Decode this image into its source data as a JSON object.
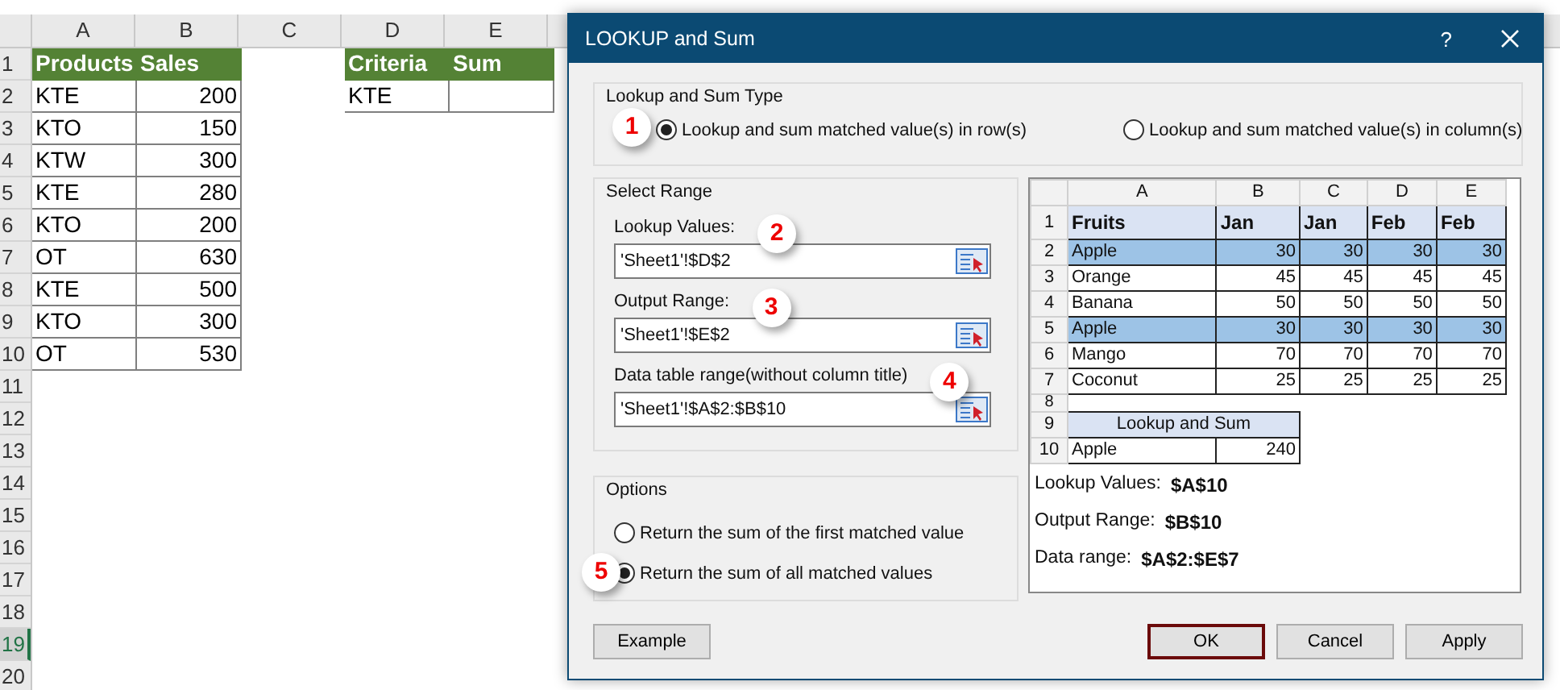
{
  "spreadsheet": {
    "columns": [
      "A",
      "B",
      "C",
      "D",
      "E"
    ],
    "row_headers": [
      {
        "label": "1",
        "selected": false
      },
      {
        "label": "2",
        "selected": false
      },
      {
        "label": "3",
        "selected": false
      },
      {
        "label": "4",
        "selected": false
      },
      {
        "label": "5",
        "selected": false
      },
      {
        "label": "6",
        "selected": false
      },
      {
        "label": "7",
        "selected": false
      },
      {
        "label": "8",
        "selected": false
      },
      {
        "label": "9",
        "selected": false
      },
      {
        "label": "10",
        "selected": false
      },
      {
        "label": "11",
        "selected": false
      },
      {
        "label": "12",
        "selected": false
      },
      {
        "label": "13",
        "selected": false
      },
      {
        "label": "14",
        "selected": false
      },
      {
        "label": "15",
        "selected": false
      },
      {
        "label": "16",
        "selected": false
      },
      {
        "label": "17",
        "selected": false
      },
      {
        "label": "18",
        "selected": false
      },
      {
        "label": "19",
        "selected": true
      },
      {
        "label": "20",
        "selected": false
      }
    ],
    "sales_table": {
      "headers": [
        "Products",
        "Sales"
      ],
      "rows": [
        [
          "KTE",
          "200"
        ],
        [
          "KTO",
          "150"
        ],
        [
          "KTW",
          "300"
        ],
        [
          "KTE",
          "280"
        ],
        [
          "KTO",
          "200"
        ],
        [
          "OT",
          "630"
        ],
        [
          "KTE",
          "500"
        ],
        [
          "KTO",
          "300"
        ],
        [
          "OT",
          "530"
        ]
      ]
    },
    "criteria_table": {
      "headers": [
        "Criteria",
        "Sum"
      ],
      "rows": [
        [
          "KTE"
        ]
      ]
    }
  },
  "dialog": {
    "title": "LOOKUP and Sum",
    "help": "?",
    "type_group": {
      "title": "Lookup and Sum Type",
      "options": [
        {
          "label": "Lookup and sum matched value(s) in row(s)",
          "selected": true,
          "badge": "1"
        },
        {
          "label": "Lookup and sum matched value(s) in column(s)",
          "selected": false
        }
      ]
    },
    "range_group": {
      "title": "Select Range",
      "fields": [
        {
          "label": "Lookup Values:",
          "value": "'Sheet1'!$D$2",
          "badge": "2"
        },
        {
          "label": "Output Range:",
          "value": "'Sheet1'!$E$2",
          "badge": "3"
        },
        {
          "label": "Data table range(without column title)",
          "value": "'Sheet1'!$A$2:$B$10",
          "badge": "4"
        }
      ]
    },
    "options_group": {
      "title": "Options",
      "options": [
        {
          "label": "Return the sum of the first matched value",
          "selected": false
        },
        {
          "label": "Return the sum of all matched values",
          "selected": true,
          "badge": "5"
        }
      ]
    },
    "preview": {
      "columns": [
        "A",
        "B",
        "C",
        "D",
        "E"
      ],
      "rows": [
        {
          "num": "1",
          "cells": [
            "Fruits",
            "Jan",
            "Jan",
            "Feb",
            "Feb"
          ],
          "kind": "header",
          "highlighted": false
        },
        {
          "num": "2",
          "cells": [
            "Apple",
            "30",
            "30",
            "30",
            "30"
          ],
          "kind": "data",
          "highlighted": true
        },
        {
          "num": "3",
          "cells": [
            "Orange",
            "45",
            "45",
            "45",
            "45"
          ],
          "kind": "data",
          "highlighted": false
        },
        {
          "num": "4",
          "cells": [
            "Banana",
            "50",
            "50",
            "50",
            "50"
          ],
          "kind": "data",
          "highlighted": false
        },
        {
          "num": "5",
          "cells": [
            "Apple",
            "30",
            "30",
            "30",
            "30"
          ],
          "kind": "data",
          "highlighted": true
        },
        {
          "num": "6",
          "cells": [
            "Mango",
            "70",
            "70",
            "70",
            "70"
          ],
          "kind": "data",
          "highlighted": false
        },
        {
          "num": "7",
          "cells": [
            "Coconut",
            "25",
            "25",
            "25",
            "25"
          ],
          "kind": "data",
          "highlighted": false
        }
      ],
      "blank_row": "8",
      "result_header_row": "9",
      "result_title": "Lookup and Sum",
      "result_row": {
        "num": "10",
        "cells": [
          "Apple",
          "240"
        ]
      },
      "notes": [
        {
          "label": "Lookup Values:",
          "value": "$A$10"
        },
        {
          "label": "Output Range:",
          "value": "$B$10"
        },
        {
          "label": "Data range:",
          "value": "$A$2:$E$7"
        }
      ]
    },
    "buttons": [
      {
        "label": "Example",
        "focused": false
      },
      {
        "label": "OK",
        "focused": true
      },
      {
        "label": "Cancel",
        "focused": false
      },
      {
        "label": "Apply",
        "focused": false
      }
    ]
  }
}
